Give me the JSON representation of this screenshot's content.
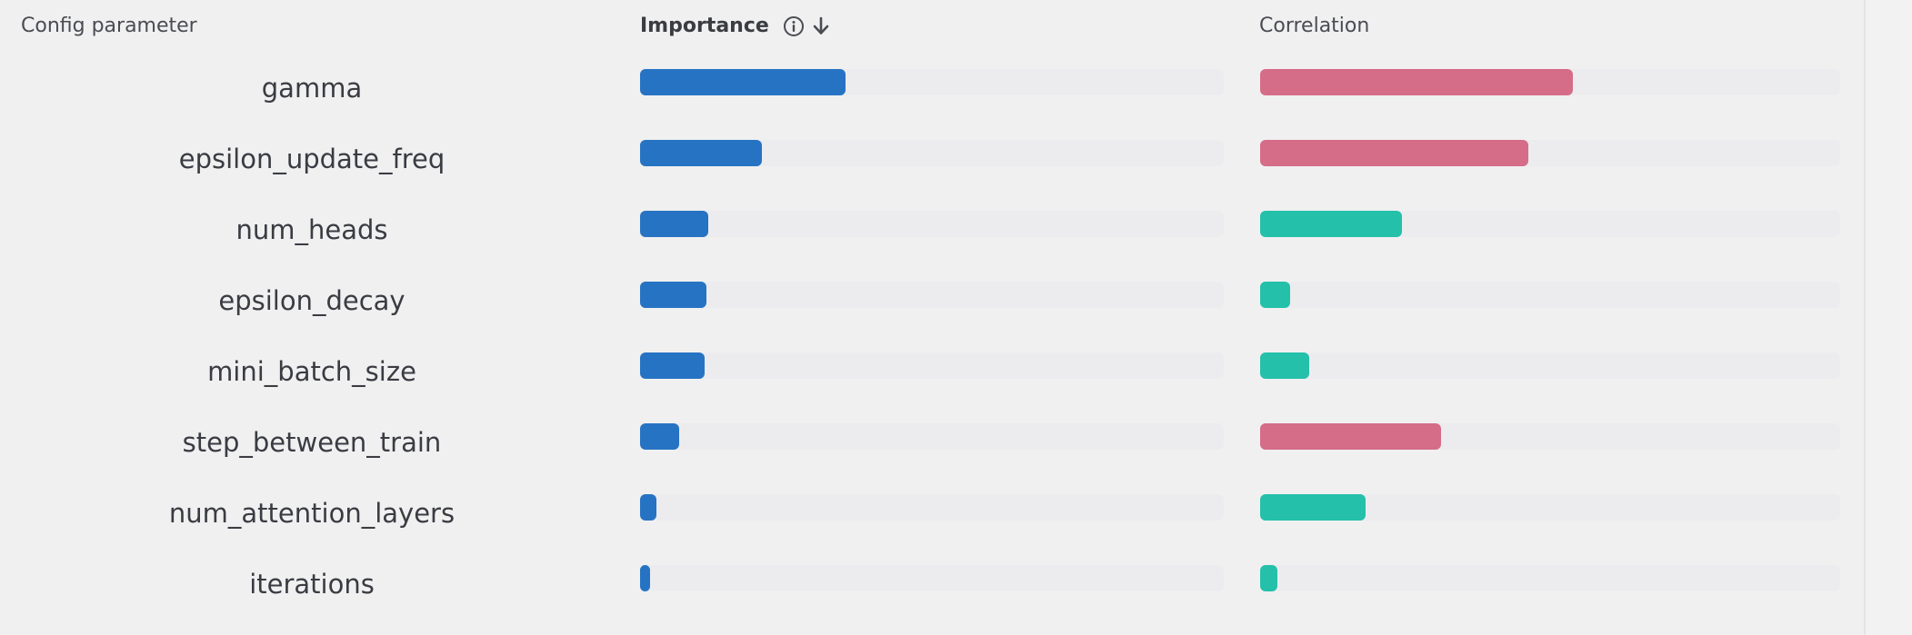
{
  "header": {
    "param_label": "Config parameter",
    "importance_label": "Importance",
    "correlation_label": "Correlation",
    "info_icon": "info-icon",
    "sort_icon": "arrow-down-icon"
  },
  "colors": {
    "importance": "#2773c3",
    "positive": "#d56c88",
    "negative": "#24c0aa"
  },
  "rows": [
    {
      "name": "gamma",
      "importance": 0.352,
      "correlation": 0.539,
      "sign": "positive"
    },
    {
      "name": "epsilon_update_freq",
      "importance": 0.209,
      "correlation": 0.462,
      "sign": "positive"
    },
    {
      "name": "num_heads",
      "importance": 0.117,
      "correlation": 0.245,
      "sign": "negative"
    },
    {
      "name": "epsilon_decay",
      "importance": 0.113,
      "correlation": 0.051,
      "sign": "negative"
    },
    {
      "name": "mini_batch_size",
      "importance": 0.111,
      "correlation": 0.085,
      "sign": "negative"
    },
    {
      "name": "step_between_train",
      "importance": 0.067,
      "correlation": 0.312,
      "sign": "positive"
    },
    {
      "name": "num_attention_layers",
      "importance": 0.028,
      "correlation": 0.182,
      "sign": "negative"
    },
    {
      "name": "iterations",
      "importance": 0.017,
      "correlation": 0.029,
      "sign": "negative"
    }
  ]
}
